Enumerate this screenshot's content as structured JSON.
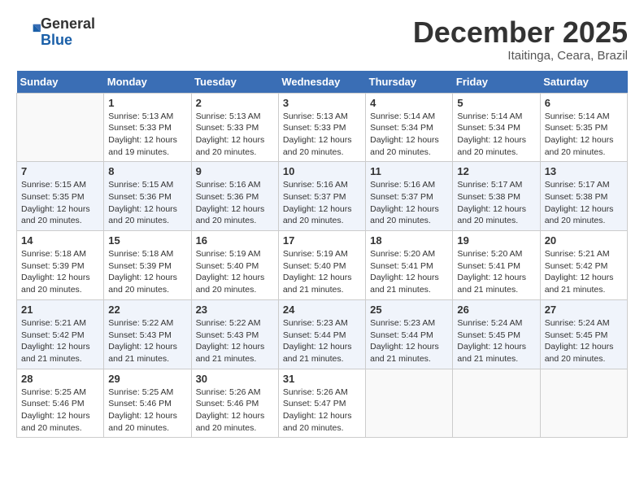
{
  "header": {
    "logo_line1": "General",
    "logo_line2": "Blue",
    "month": "December 2025",
    "location": "Itaitinga, Ceara, Brazil"
  },
  "days_of_week": [
    "Sunday",
    "Monday",
    "Tuesday",
    "Wednesday",
    "Thursday",
    "Friday",
    "Saturday"
  ],
  "weeks": [
    [
      {
        "day": "",
        "info": ""
      },
      {
        "day": "1",
        "info": "Sunrise: 5:13 AM\nSunset: 5:33 PM\nDaylight: 12 hours\nand 19 minutes."
      },
      {
        "day": "2",
        "info": "Sunrise: 5:13 AM\nSunset: 5:33 PM\nDaylight: 12 hours\nand 20 minutes."
      },
      {
        "day": "3",
        "info": "Sunrise: 5:13 AM\nSunset: 5:33 PM\nDaylight: 12 hours\nand 20 minutes."
      },
      {
        "day": "4",
        "info": "Sunrise: 5:14 AM\nSunset: 5:34 PM\nDaylight: 12 hours\nand 20 minutes."
      },
      {
        "day": "5",
        "info": "Sunrise: 5:14 AM\nSunset: 5:34 PM\nDaylight: 12 hours\nand 20 minutes."
      },
      {
        "day": "6",
        "info": "Sunrise: 5:14 AM\nSunset: 5:35 PM\nDaylight: 12 hours\nand 20 minutes."
      }
    ],
    [
      {
        "day": "7",
        "info": "Sunrise: 5:15 AM\nSunset: 5:35 PM\nDaylight: 12 hours\nand 20 minutes."
      },
      {
        "day": "8",
        "info": "Sunrise: 5:15 AM\nSunset: 5:36 PM\nDaylight: 12 hours\nand 20 minutes."
      },
      {
        "day": "9",
        "info": "Sunrise: 5:16 AM\nSunset: 5:36 PM\nDaylight: 12 hours\nand 20 minutes."
      },
      {
        "day": "10",
        "info": "Sunrise: 5:16 AM\nSunset: 5:37 PM\nDaylight: 12 hours\nand 20 minutes."
      },
      {
        "day": "11",
        "info": "Sunrise: 5:16 AM\nSunset: 5:37 PM\nDaylight: 12 hours\nand 20 minutes."
      },
      {
        "day": "12",
        "info": "Sunrise: 5:17 AM\nSunset: 5:38 PM\nDaylight: 12 hours\nand 20 minutes."
      },
      {
        "day": "13",
        "info": "Sunrise: 5:17 AM\nSunset: 5:38 PM\nDaylight: 12 hours\nand 20 minutes."
      }
    ],
    [
      {
        "day": "14",
        "info": "Sunrise: 5:18 AM\nSunset: 5:39 PM\nDaylight: 12 hours\nand 20 minutes."
      },
      {
        "day": "15",
        "info": "Sunrise: 5:18 AM\nSunset: 5:39 PM\nDaylight: 12 hours\nand 20 minutes."
      },
      {
        "day": "16",
        "info": "Sunrise: 5:19 AM\nSunset: 5:40 PM\nDaylight: 12 hours\nand 20 minutes."
      },
      {
        "day": "17",
        "info": "Sunrise: 5:19 AM\nSunset: 5:40 PM\nDaylight: 12 hours\nand 21 minutes."
      },
      {
        "day": "18",
        "info": "Sunrise: 5:20 AM\nSunset: 5:41 PM\nDaylight: 12 hours\nand 21 minutes."
      },
      {
        "day": "19",
        "info": "Sunrise: 5:20 AM\nSunset: 5:41 PM\nDaylight: 12 hours\nand 21 minutes."
      },
      {
        "day": "20",
        "info": "Sunrise: 5:21 AM\nSunset: 5:42 PM\nDaylight: 12 hours\nand 21 minutes."
      }
    ],
    [
      {
        "day": "21",
        "info": "Sunrise: 5:21 AM\nSunset: 5:42 PM\nDaylight: 12 hours\nand 21 minutes."
      },
      {
        "day": "22",
        "info": "Sunrise: 5:22 AM\nSunset: 5:43 PM\nDaylight: 12 hours\nand 21 minutes."
      },
      {
        "day": "23",
        "info": "Sunrise: 5:22 AM\nSunset: 5:43 PM\nDaylight: 12 hours\nand 21 minutes."
      },
      {
        "day": "24",
        "info": "Sunrise: 5:23 AM\nSunset: 5:44 PM\nDaylight: 12 hours\nand 21 minutes."
      },
      {
        "day": "25",
        "info": "Sunrise: 5:23 AM\nSunset: 5:44 PM\nDaylight: 12 hours\nand 21 minutes."
      },
      {
        "day": "26",
        "info": "Sunrise: 5:24 AM\nSunset: 5:45 PM\nDaylight: 12 hours\nand 21 minutes."
      },
      {
        "day": "27",
        "info": "Sunrise: 5:24 AM\nSunset: 5:45 PM\nDaylight: 12 hours\nand 20 minutes."
      }
    ],
    [
      {
        "day": "28",
        "info": "Sunrise: 5:25 AM\nSunset: 5:46 PM\nDaylight: 12 hours\nand 20 minutes."
      },
      {
        "day": "29",
        "info": "Sunrise: 5:25 AM\nSunset: 5:46 PM\nDaylight: 12 hours\nand 20 minutes."
      },
      {
        "day": "30",
        "info": "Sunrise: 5:26 AM\nSunset: 5:46 PM\nDaylight: 12 hours\nand 20 minutes."
      },
      {
        "day": "31",
        "info": "Sunrise: 5:26 AM\nSunset: 5:47 PM\nDaylight: 12 hours\nand 20 minutes."
      },
      {
        "day": "",
        "info": ""
      },
      {
        "day": "",
        "info": ""
      },
      {
        "day": "",
        "info": ""
      }
    ]
  ]
}
